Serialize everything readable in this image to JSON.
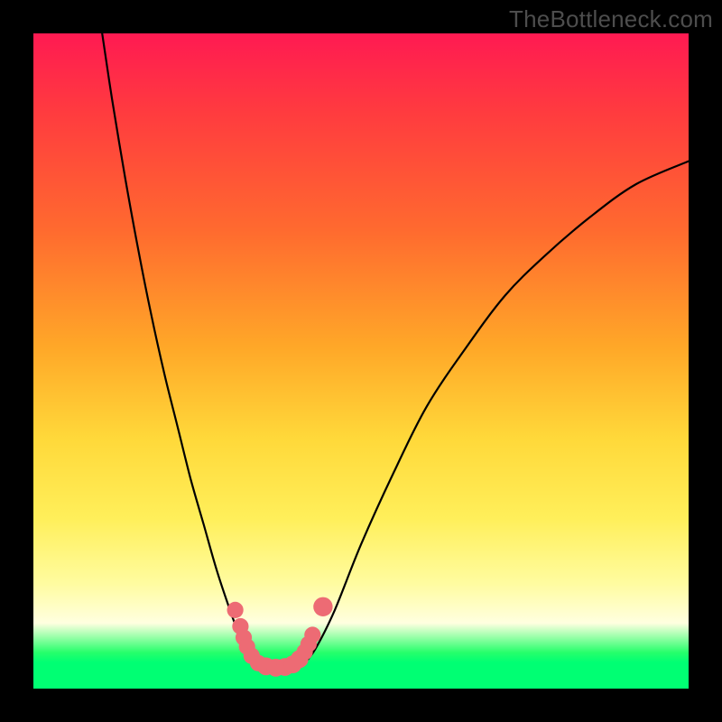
{
  "watermark": "TheBottleneck.com",
  "colors": {
    "frame": "#000000",
    "gradient_top": "#ff1a52",
    "gradient_mid": "#ffd93a",
    "gradient_bottom": "#00ff73",
    "curve_stroke": "#000000",
    "marker_fill": "#ed6b74"
  },
  "chart_data": {
    "type": "line",
    "title": "",
    "xlabel": "",
    "ylabel": "",
    "xlim": [
      0,
      100
    ],
    "ylim": [
      0,
      100
    ],
    "series": [
      {
        "name": "left-branch",
        "x": [
          10.5,
          12,
          14,
          16,
          18,
          20,
          22,
          24,
          26,
          28,
          30,
          31.5,
          33,
          34.5
        ],
        "y": [
          100,
          90,
          78,
          67,
          57,
          48,
          40,
          32,
          25,
          18,
          12,
          8,
          5,
          3.5
        ]
      },
      {
        "name": "right-branch",
        "x": [
          41,
          43,
          46,
          50,
          55,
          60,
          66,
          72,
          78,
          85,
          92,
          100
        ],
        "y": [
          3.5,
          6,
          12,
          22,
          33,
          43,
          52,
          60,
          66,
          72,
          77,
          80.5
        ]
      }
    ],
    "markers": {
      "name": "highlighted-points",
      "points": [
        {
          "x": 30.8,
          "y": 12.0,
          "r": 1.2
        },
        {
          "x": 31.6,
          "y": 9.5,
          "r": 1.2
        },
        {
          "x": 32.1,
          "y": 7.8,
          "r": 1.2
        },
        {
          "x": 32.6,
          "y": 6.4,
          "r": 1.2
        },
        {
          "x": 33.3,
          "y": 5.0,
          "r": 1.2
        },
        {
          "x": 34.3,
          "y": 3.9,
          "r": 1.2
        },
        {
          "x": 35.5,
          "y": 3.4,
          "r": 1.3
        },
        {
          "x": 37.0,
          "y": 3.2,
          "r": 1.3
        },
        {
          "x": 38.4,
          "y": 3.3,
          "r": 1.3
        },
        {
          "x": 39.6,
          "y": 3.7,
          "r": 1.3
        },
        {
          "x": 40.6,
          "y": 4.5,
          "r": 1.3
        },
        {
          "x": 41.4,
          "y": 5.6,
          "r": 1.2
        },
        {
          "x": 42.0,
          "y": 6.8,
          "r": 1.2
        },
        {
          "x": 42.6,
          "y": 8.2,
          "r": 1.2
        },
        {
          "x": 44.2,
          "y": 12.5,
          "r": 1.4
        }
      ]
    }
  }
}
